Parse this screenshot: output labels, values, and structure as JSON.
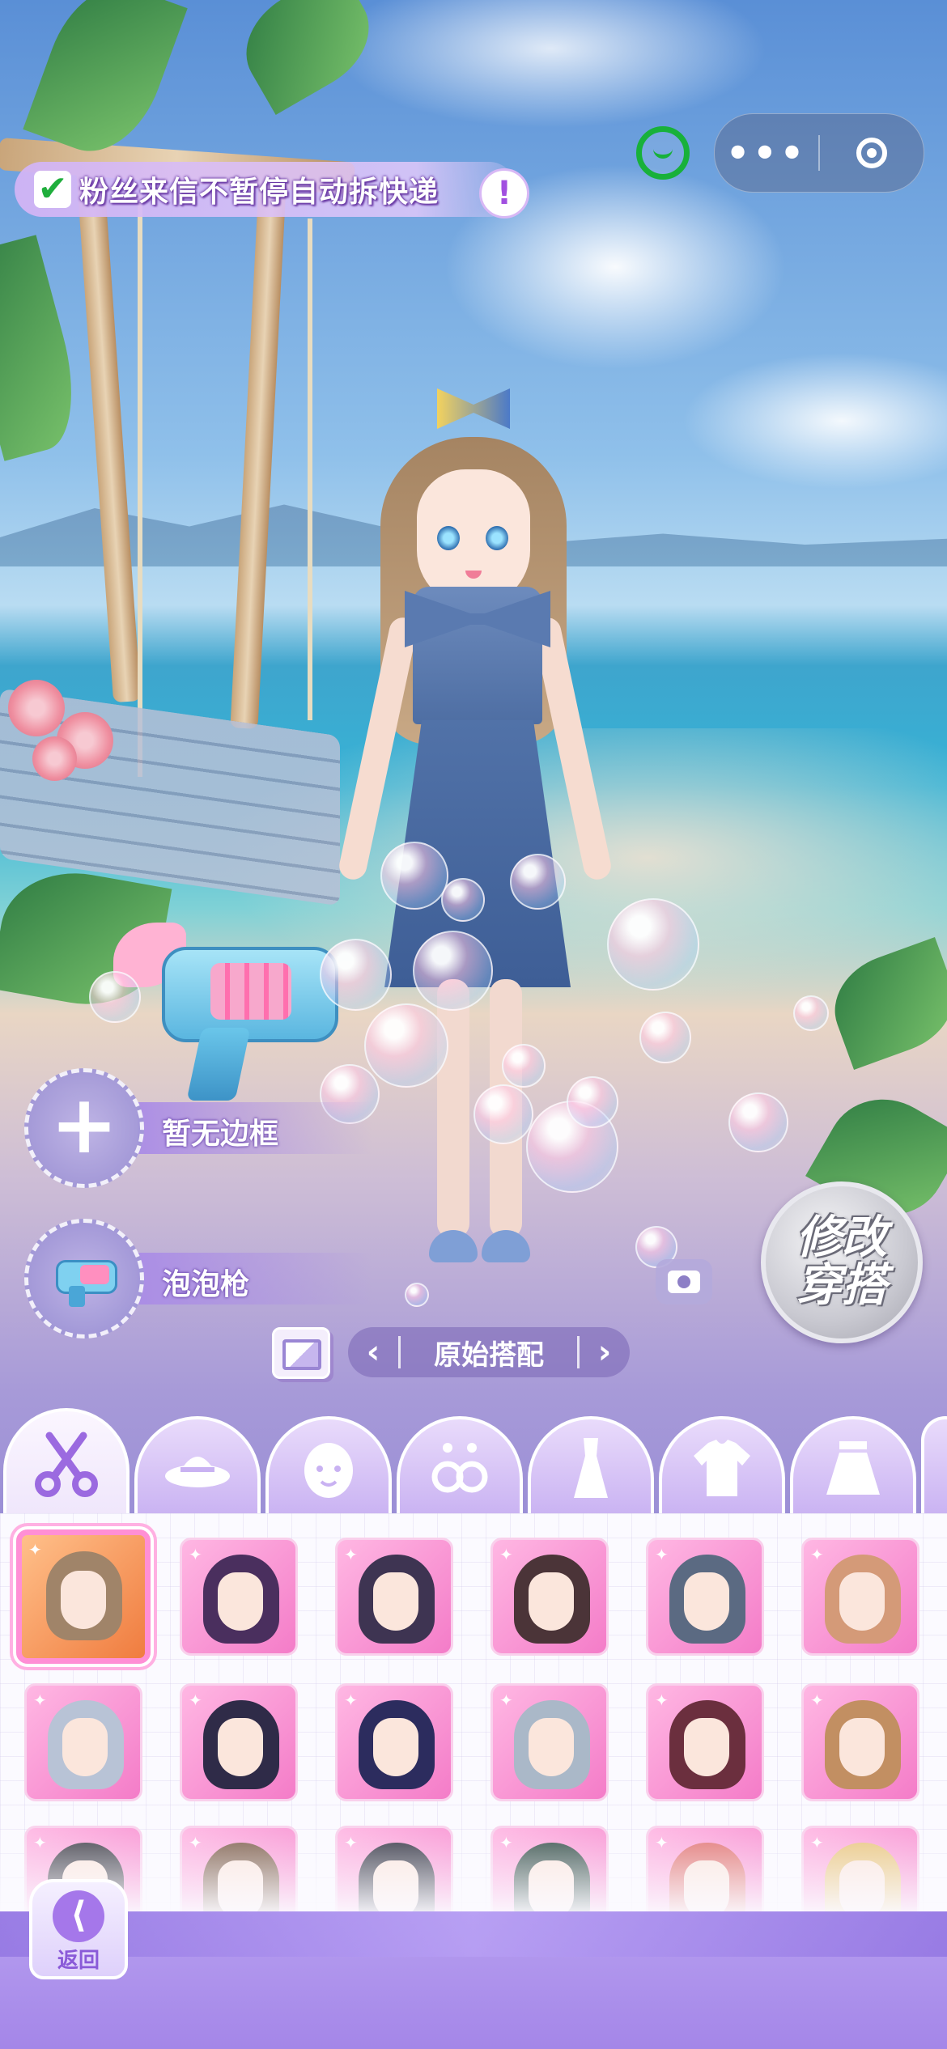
{
  "notice": {
    "checked_mark": "✔",
    "text": "粉丝来信不暂停自动拆快递",
    "warning_mark": "!"
  },
  "capsule": {
    "more_glyph": "•••",
    "close_icon": "target-circle-icon"
  },
  "slots": [
    {
      "label": "暂无边框",
      "icon": "plus-icon"
    },
    {
      "label": "泡泡枪",
      "icon": "bubble-gun-icon"
    }
  ],
  "modify_button": {
    "line1": "修改",
    "line2": "穿搭"
  },
  "outfit_nav": {
    "prev": "‹",
    "name": "原始搭配",
    "next": "›"
  },
  "tabs": [
    {
      "name": "hair",
      "icon": "scissors-icon",
      "active": true
    },
    {
      "name": "hat",
      "icon": "hat-icon",
      "active": false
    },
    {
      "name": "face",
      "icon": "face-icon",
      "active": false
    },
    {
      "name": "accessory",
      "icon": "earrings-icon",
      "active": false
    },
    {
      "name": "dress",
      "icon": "dress-icon",
      "active": false
    },
    {
      "name": "top",
      "icon": "shirt-icon",
      "active": false
    },
    {
      "name": "skirt",
      "icon": "skirt-icon",
      "active": false
    }
  ],
  "hair_items": [
    {
      "color": "#a08469",
      "selected": true
    },
    {
      "color": "#4a2f5e",
      "selected": false
    },
    {
      "color": "#3e3452",
      "selected": false
    },
    {
      "color": "#4b3438",
      "selected": false
    },
    {
      "color": "#5b6a82",
      "selected": false
    },
    {
      "color": "#d49a78",
      "selected": false
    },
    {
      "color": "#b8c3d6",
      "selected": false
    },
    {
      "color": "#2f2b48",
      "selected": false
    },
    {
      "color": "#2c2c5e",
      "selected": false
    },
    {
      "color": "#aab8c8",
      "selected": false
    },
    {
      "color": "#6b2f3e",
      "selected": false
    },
    {
      "color": "#c28f62",
      "selected": false
    },
    {
      "color": "#3a3a44",
      "selected": false
    },
    {
      "color": "#7a5a46",
      "selected": false
    },
    {
      "color": "#2d2f3e",
      "selected": false
    },
    {
      "color": "#2f4a44",
      "selected": false
    },
    {
      "color": "#e0706e",
      "selected": false
    },
    {
      "color": "#e8c47a",
      "selected": false
    }
  ],
  "back_button": {
    "label": "返回",
    "arrow": "⟨"
  },
  "colors": {
    "accent": "#a577ea",
    "check": "#1fae3c",
    "wechat": "#18b13a",
    "selected_border": "#ff8fd5"
  }
}
